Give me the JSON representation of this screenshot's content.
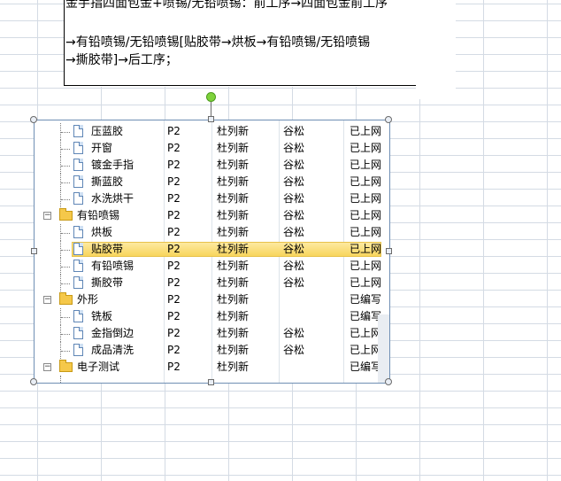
{
  "textbox": {
    "line1": "金手指四面包金+喷锡/无铅喷锡：前工序→四面包金前工序",
    "line2": "→有铅喷锡/无铅喷锡[贴胶带→烘板→有铅喷锡/无铅喷锡",
    "line3": "→撕胶带]→后工序；"
  },
  "tree": {
    "rows": [
      {
        "name": "压蓝胶",
        "code": "P2",
        "owner": "杜列新",
        "reviewer": "谷松",
        "status": "已上网",
        "type": "doc"
      },
      {
        "name": "开窗",
        "code": "P2",
        "owner": "杜列新",
        "reviewer": "谷松",
        "status": "已上网",
        "type": "doc"
      },
      {
        "name": "镀金手指",
        "code": "P2",
        "owner": "杜列新",
        "reviewer": "谷松",
        "status": "已上网",
        "type": "doc"
      },
      {
        "name": "撕蓝胶",
        "code": "P2",
        "owner": "杜列新",
        "reviewer": "谷松",
        "status": "已上网",
        "type": "doc"
      },
      {
        "name": "水洗烘干",
        "code": "P2",
        "owner": "杜列新",
        "reviewer": "谷松",
        "status": "已上网",
        "type": "doc"
      },
      {
        "name": "有铅喷锡",
        "code": "P2",
        "owner": "杜列新",
        "reviewer": "谷松",
        "status": "已上网",
        "type": "folder"
      },
      {
        "name": "烘板",
        "code": "P2",
        "owner": "杜列新",
        "reviewer": "谷松",
        "status": "已上网",
        "type": "doc"
      },
      {
        "name": "贴胶带",
        "code": "P2",
        "owner": "杜列新",
        "reviewer": "谷松",
        "status": "已上网",
        "type": "doc",
        "selected": true
      },
      {
        "name": "有铅喷锡",
        "code": "P2",
        "owner": "杜列新",
        "reviewer": "谷松",
        "status": "已上网",
        "type": "doc"
      },
      {
        "name": "撕胶带",
        "code": "P2",
        "owner": "杜列新",
        "reviewer": "谷松",
        "status": "已上网",
        "type": "doc"
      },
      {
        "name": "外形",
        "code": "P2",
        "owner": "杜列新",
        "reviewer": "",
        "status": "已编写",
        "type": "folder"
      },
      {
        "name": "铣板",
        "code": "P2",
        "owner": "杜列新",
        "reviewer": "",
        "status": "已编写",
        "type": "doc"
      },
      {
        "name": "金指倒边",
        "code": "P2",
        "owner": "杜列新",
        "reviewer": "谷松",
        "status": "已上网",
        "type": "doc"
      },
      {
        "name": "成品清洗",
        "code": "P2",
        "owner": "杜列新",
        "reviewer": "谷松",
        "status": "已上网",
        "type": "doc"
      },
      {
        "name": "电子测试",
        "code": "P2",
        "owner": "杜列新",
        "reviewer": "",
        "status": "已编写",
        "type": "folder"
      }
    ]
  },
  "icons": {
    "doc": "document-icon",
    "folder": "folder-icon",
    "expander": "collapse-icon",
    "rotate": "rotate-handle-icon"
  },
  "colors": {
    "selection": "#f8d55d",
    "folder": "#f5c84a",
    "rotate_handle": "#7ed23b"
  }
}
